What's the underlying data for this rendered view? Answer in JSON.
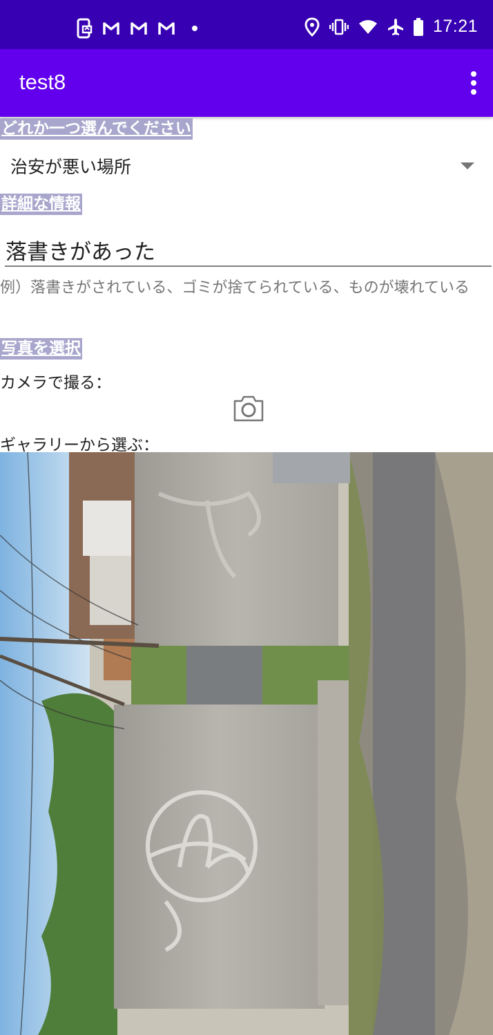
{
  "status_bar": {
    "time": "17:21",
    "left_icons": [
      "screen-share-icon",
      "gmail-icon",
      "gmail-icon",
      "gmail-icon",
      "notification-dot-icon"
    ],
    "right_icons": [
      "location-icon",
      "vibrate-icon",
      "wifi-icon",
      "airplane-icon",
      "battery-icon"
    ]
  },
  "app_bar": {
    "title": "test8",
    "menu_icon": "more-vert-icon"
  },
  "section_choose": {
    "label": "どれか一つ選んでください",
    "spinner_value": "治安が悪い場所"
  },
  "section_details": {
    "label": "詳細な情報",
    "input_value": "落書きがあった",
    "hint": "例）落書きがされている、ゴミが捨てられている、ものが壊れている"
  },
  "section_photo": {
    "label": "写真を選択",
    "camera_label": "カメラで撮る：",
    "camera_icon": "camera-icon",
    "gallery_label": "ギャラリーから選ぶ："
  },
  "colors": {
    "status_bar": "#3700b3",
    "app_bar": "#6200ee",
    "label_bg": "#a8a6cc"
  }
}
